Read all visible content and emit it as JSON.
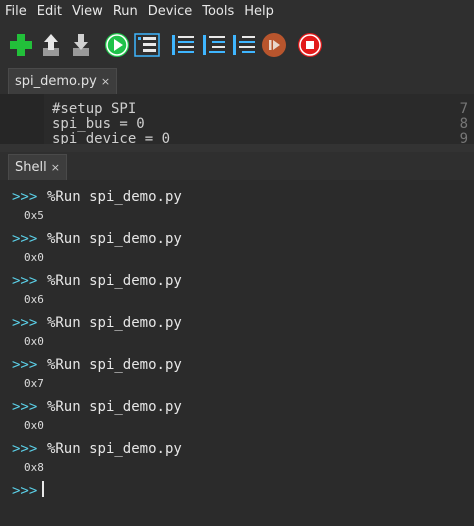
{
  "menubar": {
    "items": [
      "File",
      "Edit",
      "View",
      "Run",
      "Device",
      "Tools",
      "Help"
    ]
  },
  "toolbar": {
    "buttons": [
      "new-file",
      "load-file",
      "save-file",
      "run",
      "debug",
      "step-over",
      "step-into",
      "step-out",
      "resume",
      "stop"
    ]
  },
  "editor": {
    "tab_label": "spi_demo.py",
    "lines": [
      {
        "num": "7",
        "text": "#setup SPI"
      },
      {
        "num": "8",
        "text": "spi_bus = 0"
      },
      {
        "num": "9",
        "text": "spi_device = 0"
      }
    ]
  },
  "shell": {
    "tab_label": "Shell",
    "prompt": ">>>",
    "entries": [
      {
        "cmd": "%Run spi_demo.py",
        "out": "0x5"
      },
      {
        "cmd": "%Run spi_demo.py",
        "out": "0x0"
      },
      {
        "cmd": "%Run spi_demo.py",
        "out": "0x6"
      },
      {
        "cmd": "%Run spi_demo.py",
        "out": "0x0"
      },
      {
        "cmd": "%Run spi_demo.py",
        "out": "0x7"
      },
      {
        "cmd": "%Run spi_demo.py",
        "out": "0x0"
      },
      {
        "cmd": "%Run spi_demo.py",
        "out": "0x8"
      }
    ]
  },
  "colors": {
    "background": "#2b2b2b",
    "prompt": "#5bd0e8",
    "run_green": "#26c04a",
    "stop_red": "#e02020",
    "resume_orange": "#c0562b"
  }
}
